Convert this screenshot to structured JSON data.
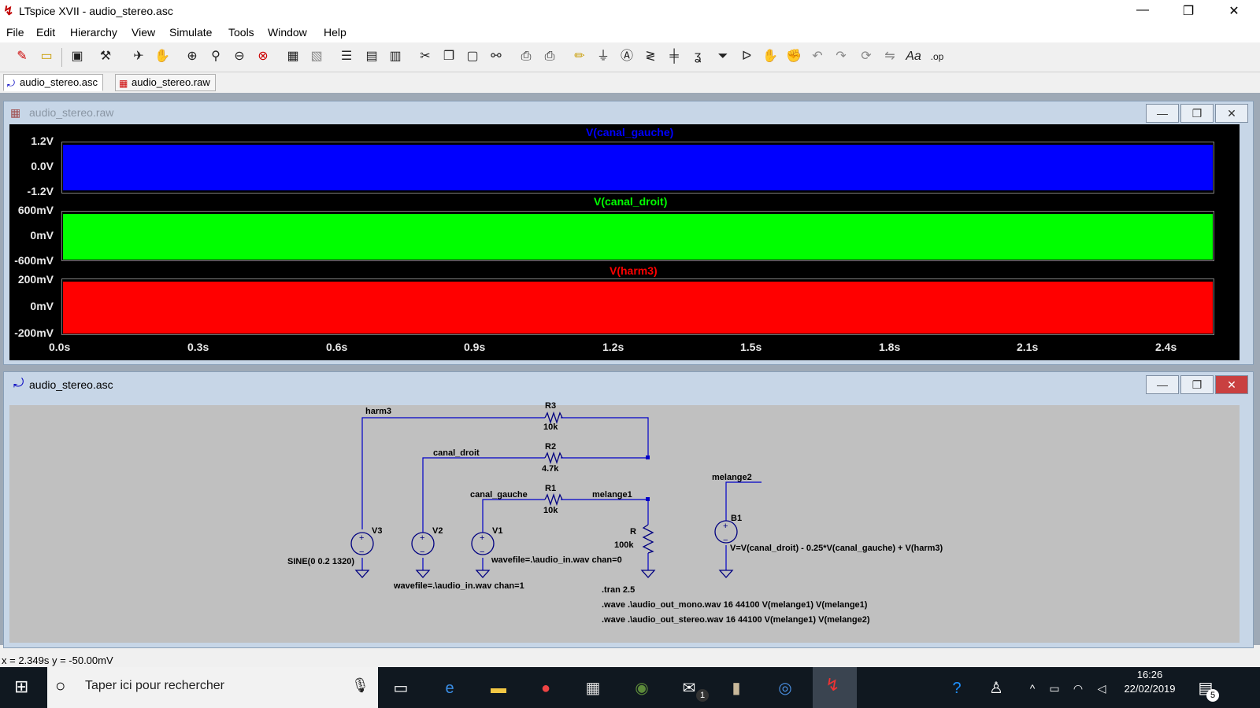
{
  "window": {
    "title": "LTspice XVII - audio_stereo.asc",
    "minimize": "—",
    "maximize": "❐",
    "close": "✕"
  },
  "menu": [
    "File",
    "Edit",
    "Hierarchy",
    "View",
    "Simulate",
    "Tools",
    "Window",
    "Help"
  ],
  "tabs": [
    {
      "label": "audio_stereo.asc",
      "active": true
    },
    {
      "label": "audio_stereo.raw",
      "active": false
    }
  ],
  "waveform_window": {
    "title": "audio_stereo.raw",
    "traces": [
      {
        "name": "V(canal_gauche)",
        "color": "#0000ff",
        "yticks": [
          "1.2V",
          "0.0V",
          "-1.2V"
        ]
      },
      {
        "name": "V(canal_droit)",
        "color": "#00ff00",
        "yticks": [
          "600mV",
          "0mV",
          "-600mV"
        ]
      },
      {
        "name": "V(harm3)",
        "color": "#ff0000",
        "yticks": [
          "200mV",
          "0mV",
          "-200mV"
        ]
      }
    ],
    "xticks": [
      "0.0s",
      "0.3s",
      "0.6s",
      "0.9s",
      "1.2s",
      "1.5s",
      "1.8s",
      "2.1s",
      "2.4s"
    ]
  },
  "schematic_window": {
    "title": "audio_stereo.asc",
    "labels": {
      "harm3": "harm3",
      "r3": "R3",
      "r3v": "10k",
      "canal_droit": "canal_droit",
      "r2": "R2",
      "r2v": "4.7k",
      "canal_gauche": "canal_gauche",
      "r1": "R1",
      "r1v": "10k",
      "melange1": "melange1",
      "melange2": "melange2",
      "v3": "V3",
      "v2": "V2",
      "v1": "V1",
      "r": "R",
      "rv": "100k",
      "b1": "B1",
      "v3val": "SINE(0 0.2 1320)",
      "v1val": "wavefile=.\\audio_in.wav chan=0",
      "v2val": "wavefile=.\\audio_in.wav chan=1",
      "b1val": "V=V(canal_droit) - 0.25*V(canal_gauche) + V(harm3)",
      "tran": ".tran 2.5",
      "wave1": ".wave .\\audio_out_mono.wav 16 44100 V(melange1) V(melange1)",
      "wave2": ".wave .\\audio_out_stereo.wav 16 44100 V(melange1) V(melange2)"
    }
  },
  "status": "x = 2.349s    y = -50.00mV",
  "taskbar": {
    "search_placeholder": "Taper ici pour rechercher",
    "time": "16:26",
    "date": "22/02/2019",
    "mail_badge": "1",
    "notif_badge": "5"
  }
}
